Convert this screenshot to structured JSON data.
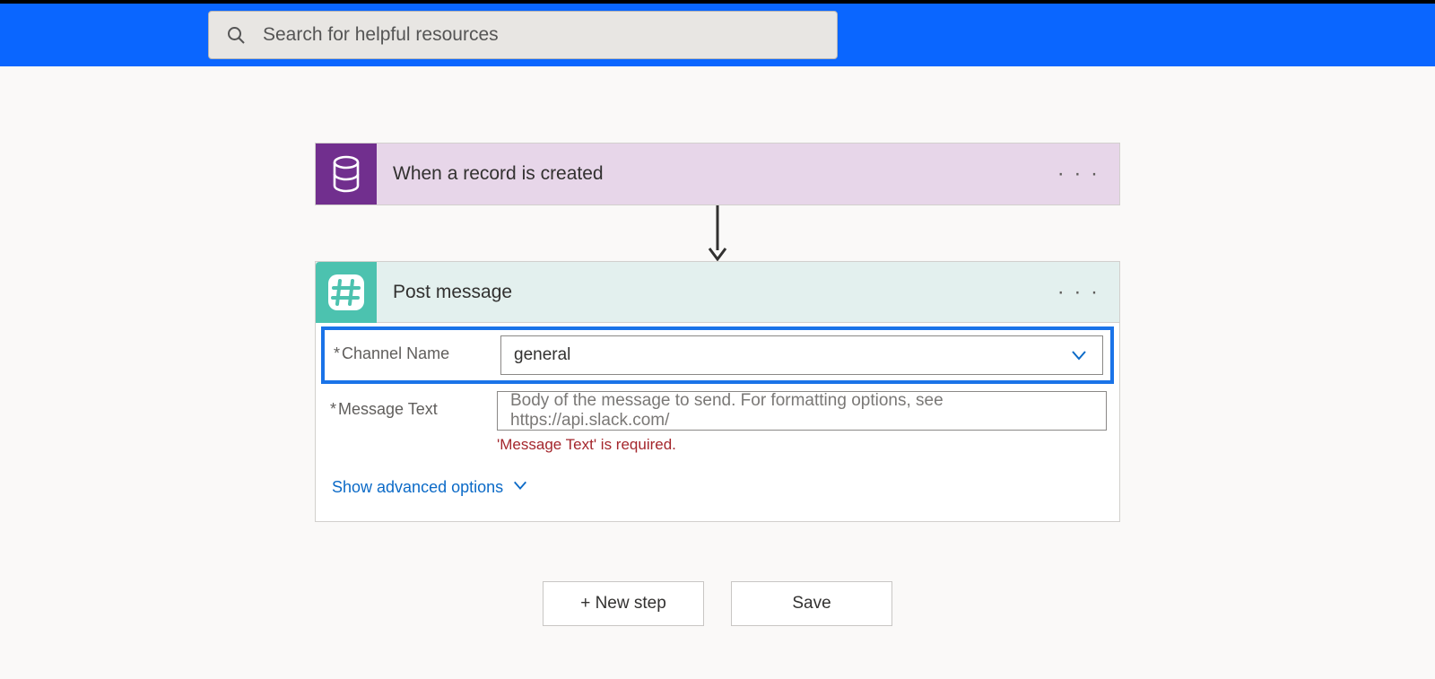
{
  "search": {
    "placeholder": "Search for helpful resources"
  },
  "trigger": {
    "title": "When a record is created",
    "icon_name": "database-icon"
  },
  "action": {
    "title": "Post message",
    "icon_name": "hash-icon",
    "fields": {
      "channel": {
        "label": "Channel Name",
        "required_mark": "*",
        "value": "general"
      },
      "message": {
        "label": "Message Text",
        "required_mark": "*",
        "placeholder": "Body of the message to send. For formatting options, see https://api.slack.com/",
        "validation": "'Message Text' is required."
      }
    },
    "advanced_label": "Show advanced options"
  },
  "footer": {
    "new_step": "+ New step",
    "save": "Save"
  }
}
